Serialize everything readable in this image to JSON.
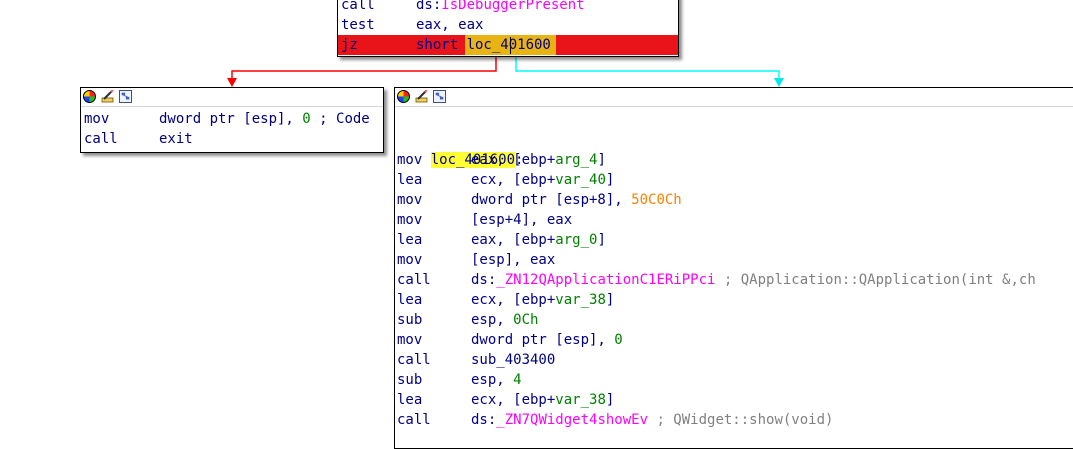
{
  "top_block": {
    "lines": [
      {
        "mnemonic": "call",
        "parts": [
          {
            "t": "ds:",
            "c": "c-navy"
          },
          {
            "t": "IsDebuggerPresent",
            "c": "c-magenta"
          }
        ]
      },
      {
        "mnemonic": "test",
        "parts": [
          {
            "t": "eax, eax",
            "c": "c-navy"
          }
        ]
      },
      {
        "mnemonic": "jz",
        "parts": [
          {
            "t": "short ",
            "c": "c-navy"
          },
          {
            "t": "loc_401600",
            "c": "c-navy"
          }
        ]
      }
    ]
  },
  "left_block": {
    "lines": [
      {
        "mnemonic": "mov",
        "parts": [
          {
            "t": "dword ptr [esp], ",
            "c": "c-navy"
          },
          {
            "t": "0",
            "c": "c-green"
          },
          {
            "t": " ; Code",
            "c": "c-navy"
          }
        ]
      },
      {
        "mnemonic": "call",
        "parts": [
          {
            "t": "exit",
            "c": "c-navy"
          }
        ]
      }
    ]
  },
  "right_block": {
    "label": "loc_401600",
    "label_suffix": ":",
    "lines": [
      {
        "mnemonic": "mov",
        "parts": [
          {
            "t": "eax, [ebp+",
            "c": "c-navy"
          },
          {
            "t": "arg_4",
            "c": "c-green"
          },
          {
            "t": "]",
            "c": "c-navy"
          }
        ]
      },
      {
        "mnemonic": "lea",
        "parts": [
          {
            "t": "ecx, [ebp+",
            "c": "c-navy"
          },
          {
            "t": "var_40",
            "c": "c-green"
          },
          {
            "t": "]",
            "c": "c-navy"
          }
        ]
      },
      {
        "mnemonic": "mov",
        "parts": [
          {
            "t": "dword ptr [esp+8], ",
            "c": "c-navy"
          },
          {
            "t": "50C0Ch",
            "c": "c-orange"
          }
        ]
      },
      {
        "mnemonic": "mov",
        "parts": [
          {
            "t": "[esp+4], eax",
            "c": "c-navy"
          }
        ]
      },
      {
        "mnemonic": "lea",
        "parts": [
          {
            "t": "eax, [ebp+",
            "c": "c-navy"
          },
          {
            "t": "arg_0",
            "c": "c-green"
          },
          {
            "t": "]",
            "c": "c-navy"
          }
        ]
      },
      {
        "mnemonic": "mov",
        "parts": [
          {
            "t": "[esp], eax",
            "c": "c-navy"
          }
        ]
      },
      {
        "mnemonic": "call",
        "parts": [
          {
            "t": "ds:",
            "c": "c-navy"
          },
          {
            "t": "_ZN12QApplicationC1ERiPPci",
            "c": "c-magenta"
          },
          {
            "t": " ; QApplication::QApplication(int &,ch",
            "c": "c-gray"
          }
        ]
      },
      {
        "mnemonic": "lea",
        "parts": [
          {
            "t": "ecx, [ebp+",
            "c": "c-navy"
          },
          {
            "t": "var_38",
            "c": "c-green"
          },
          {
            "t": "]",
            "c": "c-navy"
          }
        ]
      },
      {
        "mnemonic": "sub",
        "parts": [
          {
            "t": "esp, ",
            "c": "c-navy"
          },
          {
            "t": "0Ch",
            "c": "c-green"
          }
        ]
      },
      {
        "mnemonic": "mov",
        "parts": [
          {
            "t": "dword ptr [esp], ",
            "c": "c-navy"
          },
          {
            "t": "0",
            "c": "c-green"
          }
        ]
      },
      {
        "mnemonic": "call",
        "parts": [
          {
            "t": "sub_403400",
            "c": "c-navy"
          }
        ]
      },
      {
        "mnemonic": "sub",
        "parts": [
          {
            "t": "esp, ",
            "c": "c-navy"
          },
          {
            "t": "4",
            "c": "c-green"
          }
        ]
      },
      {
        "mnemonic": "lea",
        "parts": [
          {
            "t": "ecx, [ebp+",
            "c": "c-navy"
          },
          {
            "t": "var_38",
            "c": "c-green"
          },
          {
            "t": "]",
            "c": "c-navy"
          }
        ]
      },
      {
        "mnemonic": "call",
        "parts": [
          {
            "t": "ds:",
            "c": "c-navy"
          },
          {
            "t": "_ZN7QWidget4showEv",
            "c": "c-magenta"
          },
          {
            "t": " ; QWidget::show(void)",
            "c": "c-gray"
          }
        ]
      }
    ]
  },
  "colors": {
    "false_edge": "#ff0000",
    "true_edge": "#00ffff",
    "highlight_line": "#e8141a",
    "highlight_operand": "#e8b414",
    "label_highlight": "#ffff33"
  },
  "icons": [
    "node-color-icon",
    "rename-icon",
    "graph-overview-icon"
  ]
}
